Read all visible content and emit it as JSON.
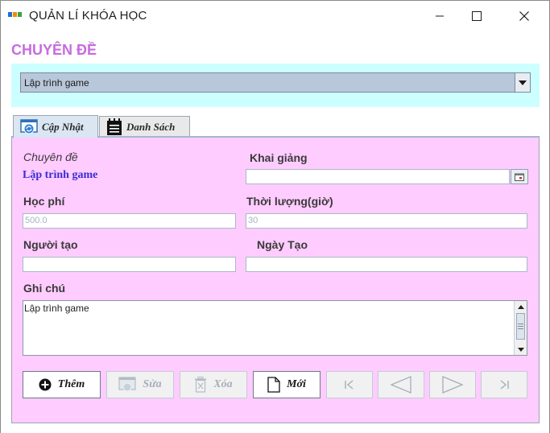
{
  "window": {
    "title": "QUẢN LÍ KHÓA HỌC"
  },
  "page": {
    "heading": "CHUYÊN ĐỀ"
  },
  "topic_selector": {
    "selected": "Lập trình game"
  },
  "tabs": [
    {
      "label": "Cập Nhật",
      "icon": "update-form-icon",
      "active": true
    },
    {
      "label": "Danh Sách",
      "icon": "list-notebook-icon",
      "active": false
    }
  ],
  "form": {
    "topic_label": "Chuyên đề",
    "topic_value": "Lập trình game",
    "start_date_label": "Khai giảng",
    "start_date_value": "",
    "fee_label": "Học phí",
    "fee_value": "500.0",
    "duration_label": "Thời lượng(giờ)",
    "duration_value": "30",
    "creator_label": "Người tạo",
    "creator_value": "",
    "created_date_label": "Ngày Tạo",
    "created_date_value": "",
    "note_label": "Ghi chú",
    "note_value": "Lập trình game"
  },
  "buttons": {
    "add": "Thêm",
    "edit": "Sửa",
    "delete": "Xóa",
    "new": "Mới"
  },
  "colors": {
    "heading": "#c76be0",
    "topic_panel": "#ccffff",
    "form_panel": "#ffccff",
    "topic_value": "#3a2bd6"
  }
}
